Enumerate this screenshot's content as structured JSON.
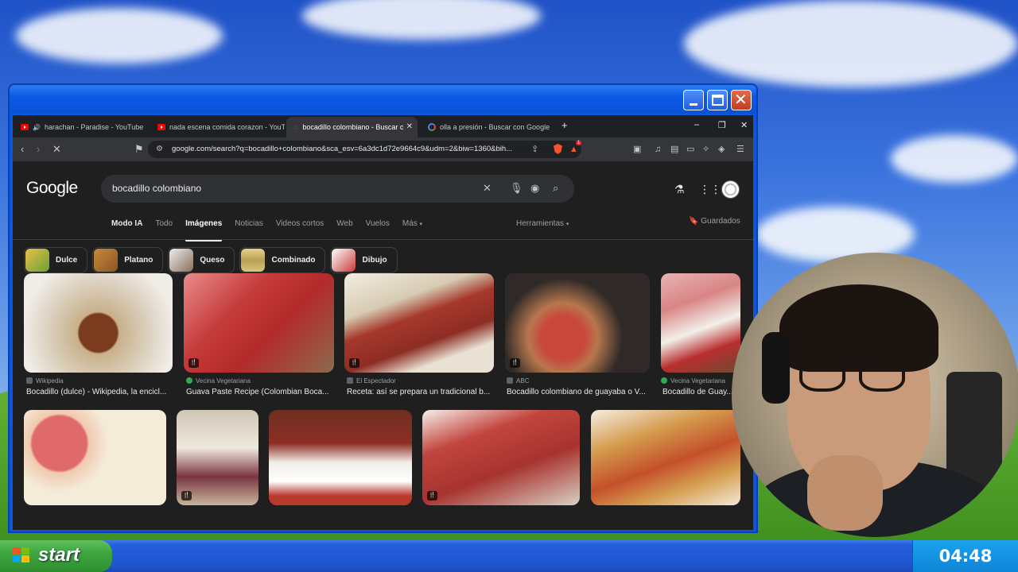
{
  "browser": {
    "tabs": [
      {
        "label": "harachan - Paradise - YouTube",
        "favicon": "youtube-icon"
      },
      {
        "label": "nada escena comida corazon - YouTu",
        "favicon": "youtube-icon"
      },
      {
        "label": "bocadillo colombiano - Buscar c",
        "favicon": "google-icon"
      },
      {
        "label": "olla a presión - Buscar con Google",
        "favicon": "google-icon"
      }
    ],
    "url": "google.com/search?q=bocadillo+colombiano&sca_esv=6a3dc1d72e9664c9&udm=2&biw=1360&bih...",
    "brave_badge": "1"
  },
  "google": {
    "logo": "Google",
    "query": "bocadillo colombiano",
    "nav": [
      "Modo IA",
      "Todo",
      "Imágenes",
      "Noticias",
      "Videos cortos",
      "Web",
      "Vuelos",
      "Más"
    ],
    "tools": "Herramientas",
    "saved": "Guardados",
    "chips": [
      "Dulce",
      "Platano",
      "Queso",
      "Combinado",
      "Dibujo"
    ],
    "results": [
      {
        "source": "Wikipedia",
        "title": "Bocadillo (dulce) - Wikipedia, la encicl..."
      },
      {
        "source": "Vecina Vegetariana",
        "title": "Guava Paste Recipe (Colombian Boca..."
      },
      {
        "source": "El Espectador",
        "title": "Receta: así se prepara un tradicional b..."
      },
      {
        "source": "ABC",
        "title": "Bocadillo colombiano de guayaba o V..."
      },
      {
        "source": "Vecina Vegetariana",
        "title": "Bocadillo de Guay..."
      }
    ]
  },
  "taskbar": {
    "start": "start",
    "clock": "04:48"
  },
  "colors": {
    "xp_blue": "#0c57e0",
    "start_green": "#3ea73e",
    "google_dark": "#1f1f1f"
  }
}
